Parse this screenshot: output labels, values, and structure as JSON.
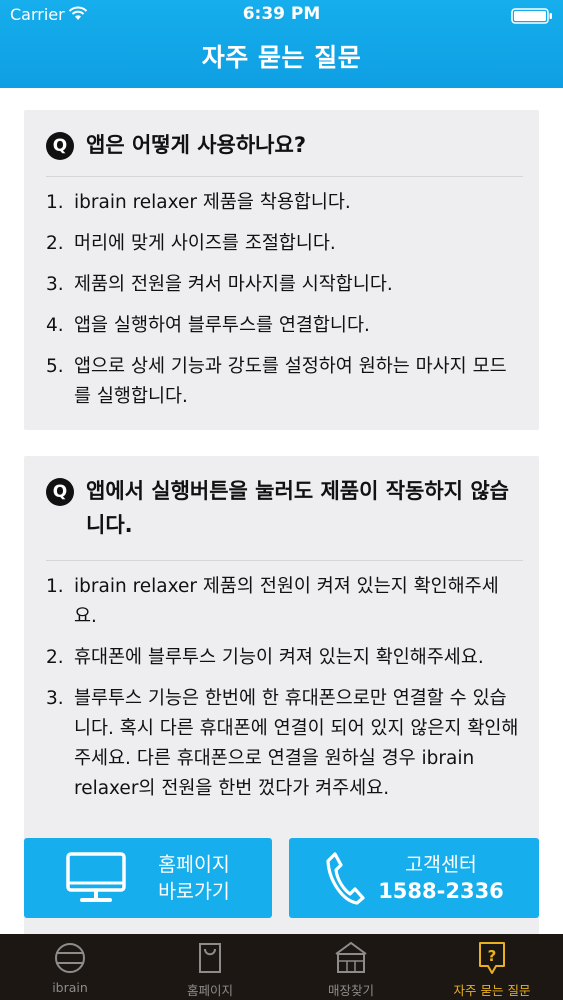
{
  "status_bar": {
    "carrier": "Carrier",
    "time": "6:39 PM"
  },
  "header": {
    "title": "자주 묻는 질문"
  },
  "faq": [
    {
      "badge": "Q",
      "question": "앱은 어떻게 사용하나요?",
      "answers": [
        {
          "num": "1.",
          "text": "ibrain relaxer 제품을 착용합니다."
        },
        {
          "num": "2.",
          "text": "머리에 맞게 사이즈를 조절합니다."
        },
        {
          "num": "3.",
          "text": "제품의 전원을 켜서 마사지를 시작합니다."
        },
        {
          "num": "4.",
          "text": "앱을 실행하여 블루투스를 연결합니다."
        },
        {
          "num": "5.",
          "text": "앱으로 상세 기능과 강도를 설정하여 원하는 마사지 모드를 실행합니다."
        }
      ]
    },
    {
      "badge": "Q",
      "question": "앱에서 실행버튼을 눌러도 제품이 작동하지 않습니다.",
      "answers": [
        {
          "num": "1.",
          "text": "ibrain relaxer 제품의 전원이 켜져 있는지 확인해주세요."
        },
        {
          "num": "2.",
          "text": "휴대폰에 블루투스 기능이 켜져 있는지 확인해주세요."
        },
        {
          "num": "3.",
          "text": "블루투스 기능은 한번에 한 휴대폰으로만 연결할 수 있습니다. 혹시 다른 휴대폰에 연결이 되어 있지 않은지 확인해주세요. 다른 휴대폰으로 연결을 원하실 경우 ibrain relaxer의 전원을 한번 껐다가 켜주세요."
        }
      ]
    }
  ],
  "buttons": {
    "homepage": {
      "line1": "홈페이지",
      "line2": "바로가기",
      "icon": "monitor-icon"
    },
    "support": {
      "line1": "고객센터",
      "line2": "1588-2336",
      "icon": "phone-icon"
    }
  },
  "tabs": [
    {
      "label": "ibrain",
      "icon": "ibrain-icon",
      "active": false
    },
    {
      "label": "홈페이지",
      "icon": "bag-icon",
      "active": false
    },
    {
      "label": "매장찾기",
      "icon": "store-icon",
      "active": false
    },
    {
      "label": "자주 묻는 질문",
      "icon": "question-icon",
      "active": true
    }
  ],
  "colors": {
    "accent": "#16aeec",
    "tab_bar": "#1c1712",
    "tab_active": "#e9b020",
    "card": "#eeeef0"
  }
}
